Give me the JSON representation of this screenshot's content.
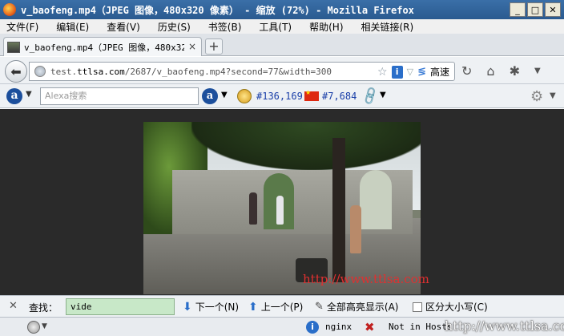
{
  "window": {
    "title": "v_baofeng.mp4（JPEG 图像，480x320 像素） - 缩放 (72%) - Mozilla Firefox",
    "buttons": {
      "minimize": "_",
      "maximize": "□",
      "close": "✕"
    }
  },
  "menubar": {
    "items": [
      {
        "label": "文件(F)"
      },
      {
        "label": "编辑(E)"
      },
      {
        "label": "查看(V)"
      },
      {
        "label": "历史(S)"
      },
      {
        "label": "书签(B)"
      },
      {
        "label": "工具(T)"
      },
      {
        "label": "帮助(H)"
      },
      {
        "label": "相关链接(R)"
      }
    ]
  },
  "tabs": {
    "active_label": "v_baofeng.mp4（JPEG 图像，480x320",
    "close": "×",
    "new_tab": "+"
  },
  "navbar": {
    "url_prefix": "test.",
    "url_domain": "ttlsa.com",
    "url_path": "/2687/v_baofeng.mp4?second=77&width=300",
    "speed_label": "高速",
    "icons": [
      "back-arrow-icon",
      "globe-icon",
      "star-icon",
      "info-icon",
      "speed-icon",
      "reload-icon",
      "home-icon",
      "puzzle-icon",
      "menu-dropdown-icon"
    ]
  },
  "alexa": {
    "search_placeholder": "Alexa搜索",
    "global_rank": "#136,169",
    "china_rank": "#7,684"
  },
  "content": {
    "watermark": "http://www.ttlsa.com"
  },
  "findbar": {
    "label": "查找：",
    "value": "vide",
    "next_label": "下一个(N)",
    "prev_label": "上一个(P)",
    "highlight_label": "全部高亮显示(A)",
    "match_case_label": "区分大小写(C)"
  },
  "statusbar": {
    "server": "nginx",
    "hosts": "Not in Hosts",
    "watermark": "http://www.ttlsa.com"
  }
}
